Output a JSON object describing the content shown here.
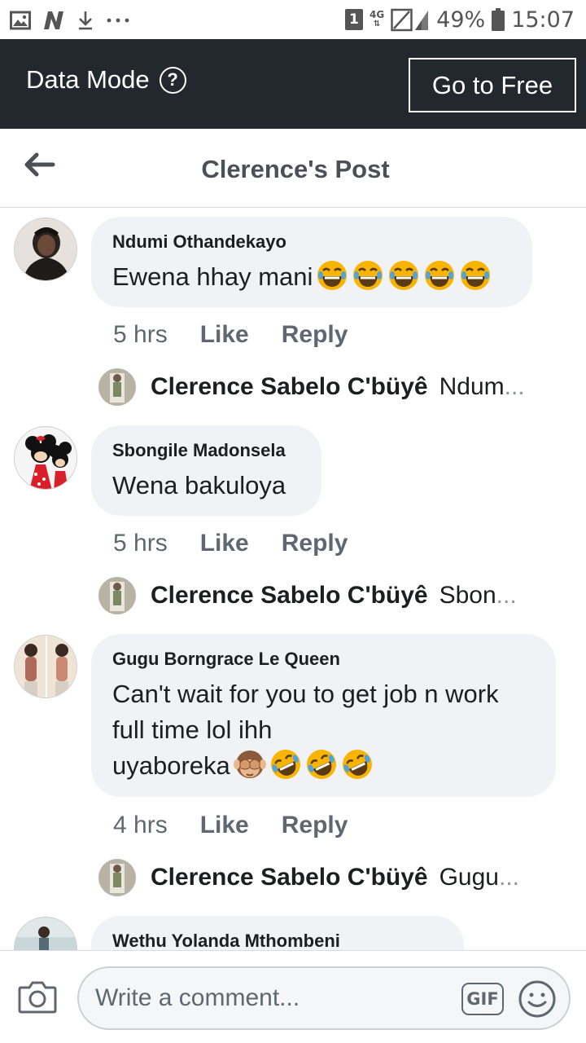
{
  "status_bar": {
    "sim_badge": "1",
    "network": "4G",
    "battery_percent": "49%",
    "time": "15:07"
  },
  "data_mode_bar": {
    "label": "Data Mode",
    "help_glyph": "?",
    "button_label": "Go to Free"
  },
  "header": {
    "title": "Clerence's Post"
  },
  "comments": [
    {
      "author": "Ndumi Othandekayo",
      "text": "Ewena hhay mani",
      "emojis": [
        "joy-emoji",
        "joy-emoji",
        "joy-emoji",
        "joy-emoji",
        "joy-emoji"
      ],
      "time": "5 hrs",
      "like_label": "Like",
      "reply_label": "Reply",
      "reply": {
        "author": "Clerence Sabelo C'büyê",
        "snippet": "Ndum",
        "ellipsis": "..."
      }
    },
    {
      "author": "Sbongile Madonsela",
      "text": "Wena bakuloya",
      "emojis": [],
      "time": "5 hrs",
      "like_label": "Like",
      "reply_label": "Reply",
      "reply": {
        "author": "Clerence Sabelo C'büyê",
        "snippet": "Sbon",
        "ellipsis": "..."
      }
    },
    {
      "author": "Gugu Borngrace Le Queen",
      "text_line1": "Can't wait for you to get job n work",
      "text_line2": "full time lol ihh",
      "text_line3": "uyaboreka",
      "emojis": [
        "see-no-evil-monkey-emoji",
        "rofl-emoji",
        "rofl-emoji",
        "rofl-emoji"
      ],
      "time": "4 hrs",
      "like_label": "Like",
      "reply_label": "Reply",
      "reply": {
        "author": "Clerence Sabelo C'büyê",
        "snippet": "Gugu",
        "ellipsis": "..."
      }
    },
    {
      "author": "Wethu Yolanda Mthombeni"
    }
  ],
  "composer": {
    "placeholder": "Write a comment...",
    "gif_label": "GIF"
  },
  "colors": {
    "data_bar_bg": "#23272e",
    "bubble_bg": "#f0f2f5",
    "secondary_text": "#606770",
    "header_title": "#4b4f56",
    "emoji_yellow": "#f7b500"
  }
}
